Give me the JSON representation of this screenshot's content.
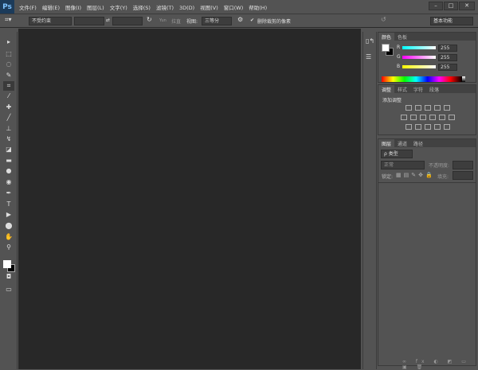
{
  "app": {
    "logo": "Ps"
  },
  "menu": [
    "文件(F)",
    "编辑(E)",
    "图像(I)",
    "图层(L)",
    "文字(Y)",
    "选择(S)",
    "滤镜(T)",
    "3D(D)",
    "视图(V)",
    "窗口(W)",
    "帮助(H)"
  ],
  "window_controls": {
    "minimize": "–",
    "restore": "□",
    "close": "✕"
  },
  "options": {
    "ratio": "不受约束",
    "width": "",
    "height": "",
    "straighten": "拉直",
    "view_label": "视图:",
    "view_value": "三等分",
    "delete_cropped": "删除裁剪的像素",
    "delete_checked": true,
    "workspace": "基本功能"
  },
  "tools": [
    "move",
    "marquee",
    "lasso",
    "quick-select",
    "crop",
    "eyedropper",
    "healing",
    "brush",
    "stamp",
    "history-brush",
    "eraser",
    "gradient",
    "blur",
    "dodge",
    "pen",
    "type",
    "path-select",
    "shape",
    "hand",
    "zoom"
  ],
  "colors": {
    "foreground": "#ffffff",
    "background": "#000000",
    "canvas": "#282828"
  },
  "color_panel": {
    "tabs": [
      "颜色",
      "色板"
    ],
    "channels": [
      {
        "label": "R",
        "value": "255"
      },
      {
        "label": "G",
        "value": "255"
      },
      {
        "label": "B",
        "value": "255"
      }
    ]
  },
  "adjust_panel": {
    "tabs": [
      "调整",
      "样式",
      "字符",
      "段落"
    ],
    "title": "添加调整"
  },
  "layers_panel": {
    "tabs": [
      "图层",
      "通道",
      "路径"
    ],
    "filter": "ρ 类型",
    "blend": "正常",
    "opacity_label": "不透明度:",
    "lock_label": "锁定:",
    "fill_label": "填充:"
  }
}
